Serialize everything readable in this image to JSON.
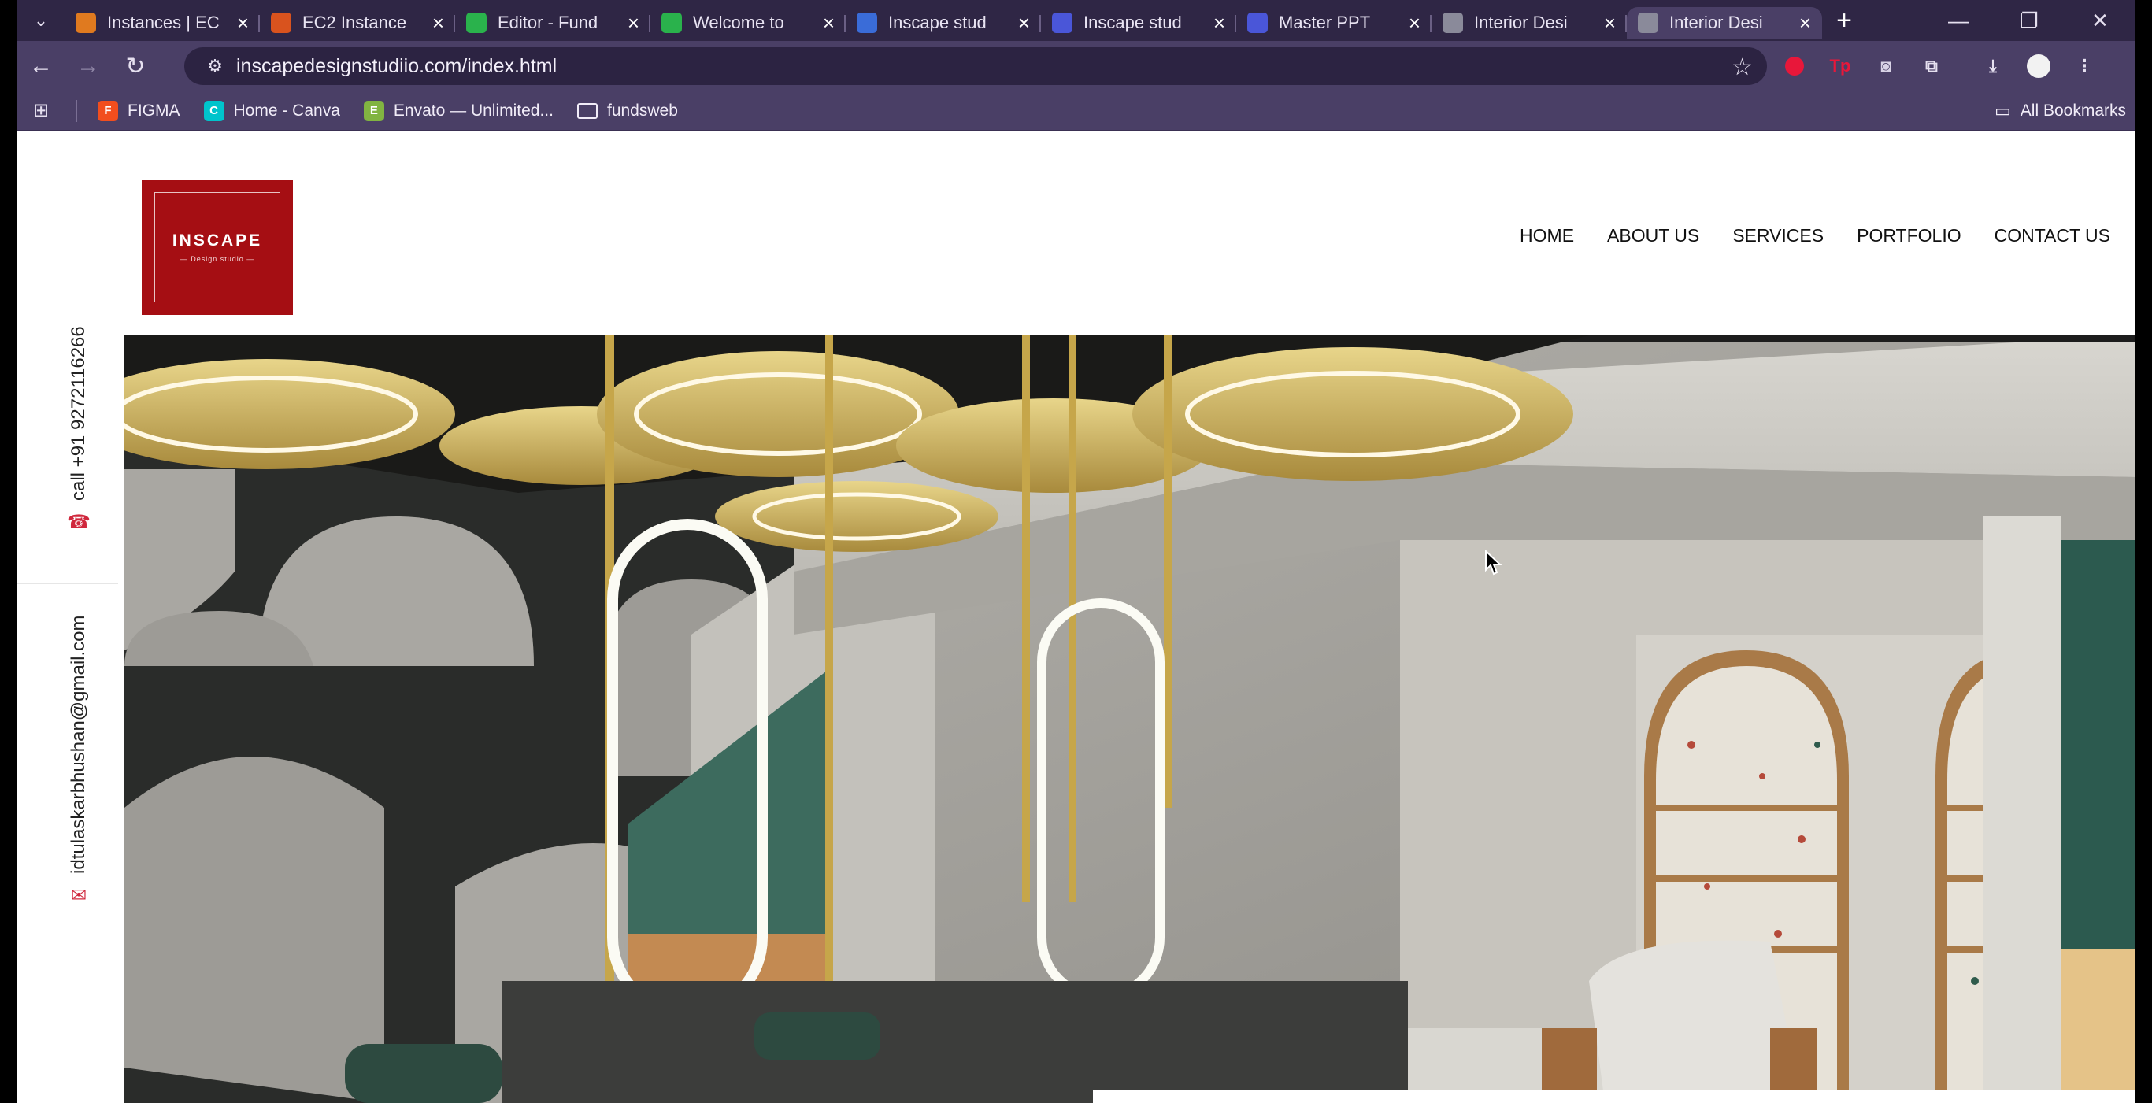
{
  "browser": {
    "tabs": [
      {
        "label": "Instances | EC",
        "favicon": "aws-orange-icon",
        "color": "#e07a1f"
      },
      {
        "label": "EC2 Instance",
        "favicon": "aws-orange-icon",
        "color": "#d9531e"
      },
      {
        "label": "Editor - Fund",
        "favicon": "green-k-icon",
        "color": "#2ab24c"
      },
      {
        "label": "Welcome to",
        "favicon": "green-k-icon",
        "color": "#2ab24c"
      },
      {
        "label": "Inscape stud",
        "favicon": "blue-globe-icon",
        "color": "#3a6cd8"
      },
      {
        "label": "Inscape stud",
        "favicon": "blue-shield-icon",
        "color": "#4a56d8"
      },
      {
        "label": "Master PPT",
        "favicon": "blue-shield-icon",
        "color": "#4a56d8"
      },
      {
        "label": "Interior Desi",
        "favicon": "globe-icon",
        "color": "#8a8a9a"
      },
      {
        "label": "Interior Desi",
        "favicon": "globe-icon",
        "color": "#8a8a9a",
        "active": true
      }
    ],
    "new_tab_symbol": "+",
    "url": "inscapedesignstudiio.com/index.html",
    "bookmarks": [
      {
        "label": "FIGMA",
        "color": "#f24e1e",
        "glyph": "F"
      },
      {
        "label": "Home - Canva",
        "color": "#00c4cc",
        "glyph": "C"
      },
      {
        "label": "Envato — Unlimited...",
        "color": "#81b441",
        "glyph": "E"
      },
      {
        "label": "fundsweb",
        "color": "folder",
        "glyph": "▭"
      }
    ],
    "all_bookmarks": "All Bookmarks"
  },
  "site": {
    "logo": {
      "brand": "INSCAPE",
      "tagline": "— Design studio —",
      "bg": "#a50e13"
    },
    "nav": [
      "HOME",
      "ABOUT US",
      "SERVICES",
      "PORTFOLIO",
      "CONTACT US"
    ],
    "side": {
      "phone": "call +91 9272116266",
      "email": "idtulaskarbhushan@gmail.com"
    }
  }
}
